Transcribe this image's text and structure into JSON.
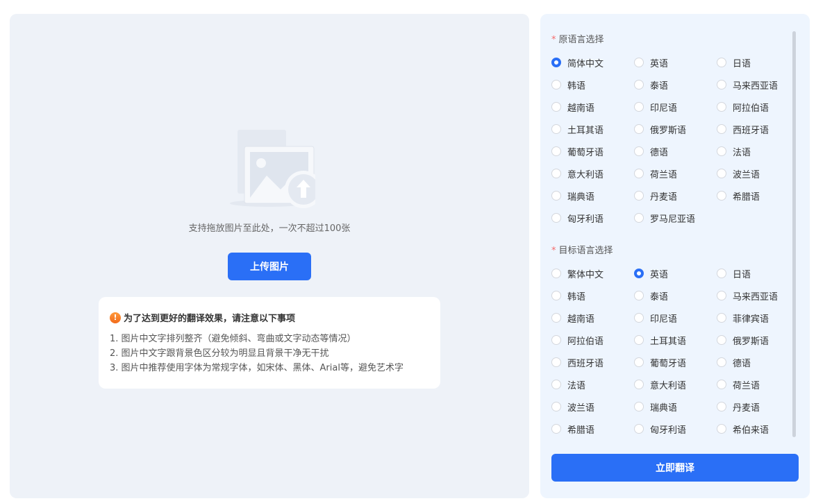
{
  "upload": {
    "hint": "支持拖放图片至此处，一次不超过100张",
    "button_label": "上传图片"
  },
  "notice": {
    "icon": "!",
    "title": "为了达到更好的翻译效果，请注意以下事项",
    "items": [
      "1. 图片中文字排列整齐（避免倾斜、弯曲或文字动态等情况）",
      "2. 图片中文字跟背景色区分较为明显且背景干净无干扰",
      "3. 图片中推荐使用字体为常规字体，如宋体、黑体、Arial等，避免艺术字"
    ]
  },
  "source": {
    "required_mark": "*",
    "label": "原语言选择",
    "selected": "简体中文",
    "options": [
      "简体中文",
      "英语",
      "日语",
      "韩语",
      "泰语",
      "马来西亚语",
      "越南语",
      "印尼语",
      "阿拉伯语",
      "土耳其语",
      "俄罗斯语",
      "西班牙语",
      "葡萄牙语",
      "德语",
      "法语",
      "意大利语",
      "荷兰语",
      "波兰语",
      "瑞典语",
      "丹麦语",
      "希腊语",
      "匈牙利语",
      "罗马尼亚语"
    ]
  },
  "target": {
    "required_mark": "*",
    "label": "目标语言选择",
    "selected": "英语",
    "options": [
      "繁体中文",
      "英语",
      "日语",
      "韩语",
      "泰语",
      "马来西亚语",
      "越南语",
      "印尼语",
      "菲律宾语",
      "阿拉伯语",
      "土耳其语",
      "俄罗斯语",
      "西班牙语",
      "葡萄牙语",
      "德语",
      "法语",
      "意大利语",
      "荷兰语",
      "波兰语",
      "瑞典语",
      "丹麦语",
      "希腊语",
      "匈牙利语",
      "希伯来语"
    ]
  },
  "translate_button_label": "立即翻译",
  "colors": {
    "accent": "#2a6ff6",
    "required": "#f56c6c",
    "warning": "#f26a1b"
  }
}
